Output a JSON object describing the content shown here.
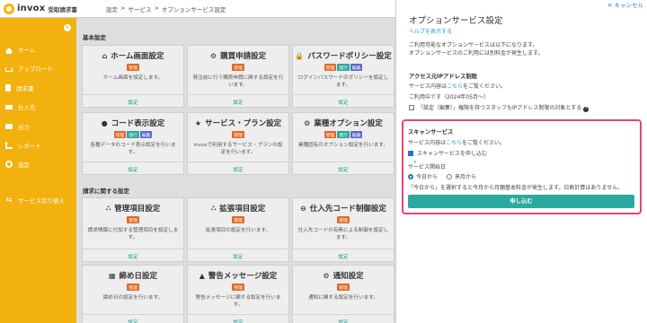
{
  "header": {
    "logo": "invox",
    "product": "受取請求書",
    "breadcrumb": [
      "設定",
      ">",
      "サービス",
      ">",
      "オプションサービス設定"
    ]
  },
  "sidebar": {
    "items": [
      {
        "label": "ホーム",
        "icon": "home-icon"
      },
      {
        "label": "アップロード",
        "icon": "upload-icon"
      },
      {
        "label": "請求書",
        "icon": "document-icon"
      },
      {
        "label": "仕入先",
        "icon": "truck-icon"
      },
      {
        "label": "出力",
        "icon": "print-icon"
      },
      {
        "label": "レポート",
        "icon": "chart-icon"
      },
      {
        "label": "設定",
        "icon": "gear-icon"
      },
      {
        "label": "サービス切り替え",
        "icon": "switch-icon"
      }
    ],
    "toggle": "«"
  },
  "main": {
    "sections": [
      "基本設定",
      "請求に関する設定"
    ],
    "badges": {
      "admin": "管理",
      "issue": "発行",
      "edit": "編集"
    },
    "cards": [
      {
        "title": "ホーム画面設定",
        "icon": "home-icon",
        "glyph": "⌂",
        "badges": [
          "admin"
        ],
        "desc": "ホーム画面を設定します。",
        "link": "設定"
      },
      {
        "title": "購買申請設定",
        "icon": "gears-icon",
        "glyph": "⚙",
        "badges": [
          "admin"
        ],
        "desc": "発注前に行う購買申請に関する設定を行います。",
        "link": "設定"
      },
      {
        "title": "パスワードポリシー設定",
        "icon": "lock-icon",
        "glyph": "🔒",
        "badges": [
          "admin",
          "issue",
          "edit"
        ],
        "desc": "ログインパスワードのポリシーを設定します。",
        "link": "設定"
      },
      {
        "title": "コード表示設定",
        "icon": "code-icon",
        "glyph": "●",
        "badges": [
          "admin",
          "issue",
          "edit"
        ],
        "desc": "各種データのコード表示設定を行います。",
        "link": "設定"
      },
      {
        "title": "サービス・プラン設定",
        "icon": "star-icon",
        "glyph": "★",
        "badges": [
          "admin"
        ],
        "desc": "invoxで利用するサービス・プランの設定を行います。",
        "link": "設定"
      },
      {
        "title": "業種オプション設定",
        "icon": "gears-icon",
        "glyph": "⚙",
        "badges": [
          "admin",
          "issue",
          "edit"
        ],
        "desc": "業種固有のオプション設定を行います。",
        "link": "設定"
      },
      {
        "title": "管理項目設定",
        "icon": "tree-icon",
        "glyph": "⛬",
        "badges": [
          "admin"
        ],
        "desc": "請求情報に付加する管理項目を設定します。",
        "link": "設定"
      },
      {
        "title": "拡張項目設定",
        "icon": "tree-icon",
        "glyph": "⛬",
        "badges": [
          "admin"
        ],
        "desc": "拡張項目の設定を行います。",
        "link": "設定"
      },
      {
        "title": "仕入先コード制御設定",
        "icon": "minus-circle-icon",
        "glyph": "⊖",
        "badges": [
          "admin"
        ],
        "desc": "仕入先コードの有無による制御を設定します。",
        "link": "設定"
      },
      {
        "title": "締め日設定",
        "icon": "calendar-icon",
        "glyph": "▦",
        "badges": [
          "admin"
        ],
        "desc": "締め日の設定を行います。",
        "link": "設定"
      },
      {
        "title": "警告メッセージ設定",
        "icon": "warning-icon",
        "glyph": "▲",
        "badges": [
          "admin"
        ],
        "desc": "警告メッセージに関する設定を行います。",
        "link": "設定"
      },
      {
        "title": "通知設定",
        "icon": "gears-icon",
        "glyph": "⚙",
        "badges": [
          "admin"
        ],
        "desc": "通知に関する設定を行います。",
        "link": "設定"
      }
    ]
  },
  "panel": {
    "cancel": "✕ キャンセル",
    "title": "オプションサービス設定",
    "help": "ヘルプを表示する",
    "intro1": "ご利用可能なオプションサービスは以下になります。",
    "intro2": "オプションサービスのご利用には別料金が発生します。",
    "ip": {
      "heading": "アクセス元IPアドレス制限",
      "detail_pre": "サービス内容は",
      "detail_link": "こちら",
      "detail_post": "をご覧ください。",
      "status": "ご利用中です（2024年05月～）",
      "checkbox_label": "「設定（編集）」権限を持つスタッフもIPアドレス制限の対象とする",
      "checkbox_checked": false,
      "info": "?"
    },
    "scan": {
      "heading": "スキャンサービス",
      "detail_pre": "サービス内容は",
      "detail_link": "こちら",
      "detail_post": "をご覧ください。",
      "checkbox_label": "スキャンサービスを申し込む",
      "checkbox_checked": true,
      "start_label": "サービス開始日",
      "options": [
        "今日から",
        "来月から"
      ],
      "selected": "今日から",
      "note": "「今日から」を選択すると今月から月額基本料金が発生します。日割計算はありません。",
      "apply": "申し込む"
    },
    "expand": "›"
  },
  "colors": {
    "sidebar": "#f3b10d",
    "accent": "#2ba99e",
    "highlight": "#e2457a"
  }
}
